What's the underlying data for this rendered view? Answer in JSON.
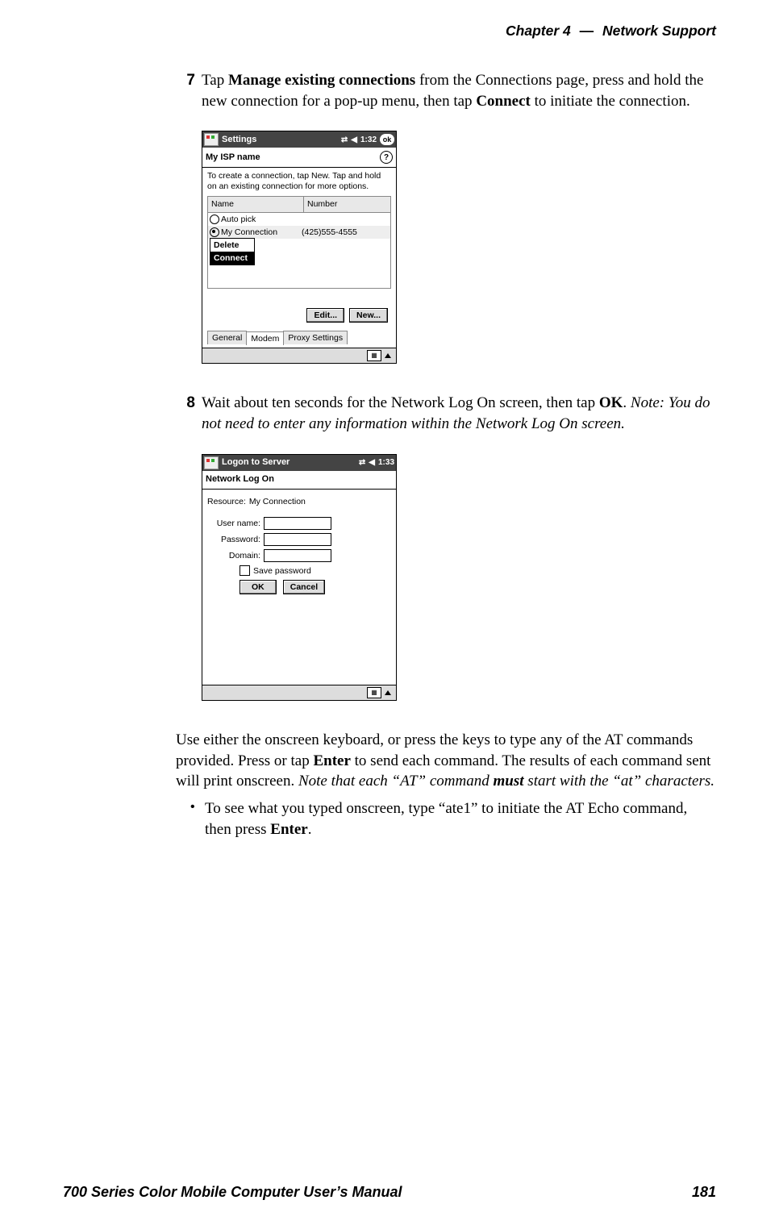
{
  "header": {
    "chapter_word": "Chapter",
    "chapter_num": "4",
    "dash": "—",
    "title": "Network Support"
  },
  "step7": {
    "num": "7",
    "t1": "Tap ",
    "b1": "Manage existing connections",
    "t2": " from the Connections page, press and hold the new connection for a pop-up menu, then tap ",
    "b2": "Connect",
    "t3": " to initiate the connection."
  },
  "dev1": {
    "tb_title": "Settings",
    "tb_time": "1:32",
    "ok": "ok",
    "sub": "My ISP name",
    "hint": "To create a connection, tap New. Tap and hold on an existing connection for more options.",
    "col_name": "Name",
    "col_num": "Number",
    "row1_name": "Auto pick",
    "row2_name": "My Connection",
    "row2_num": "(425)555-4555",
    "popup_delete": "Delete",
    "popup_connect": "Connect",
    "btn_edit": "Edit...",
    "btn_new": "New...",
    "tab_general": "General",
    "tab_modem": "Modem",
    "tab_proxy": "Proxy Settings"
  },
  "step8": {
    "num": "8",
    "t1": "Wait about ten seconds for the Network Log On screen, then tap ",
    "b1": "OK",
    "t2": ". ",
    "i1": "Note: You do not need to enter any information within the Network Log On screen."
  },
  "dev2": {
    "tb_title": "Logon to Server",
    "tb_time": "1:33",
    "sub": "Network Log On",
    "resource_lbl": "Resource:",
    "resource_val": "My Connection",
    "user_lbl": "User name:",
    "pwd_lbl": "Password:",
    "dom_lbl": "Domain:",
    "save_pwd": "Save password",
    "ok": "OK",
    "cancel": "Cancel"
  },
  "para": {
    "t1": "Use either the onscreen keyboard, or press the keys to type any of the AT commands provided. Press or tap ",
    "b1": "Enter",
    "t2": " to send each command. The results of each command sent will print onscreen. ",
    "i1": "Note that each “AT” command ",
    "bi1": "must",
    "i2": " start with the “at” characters."
  },
  "bullet": {
    "t1": "To see what you typed onscreen, type “ate1” to initiate the AT Echo command, then press ",
    "b1": "Enter",
    "t2": "."
  },
  "footer": {
    "left": "700 Series Color Mobile Computer User’s Manual",
    "right": "181"
  }
}
